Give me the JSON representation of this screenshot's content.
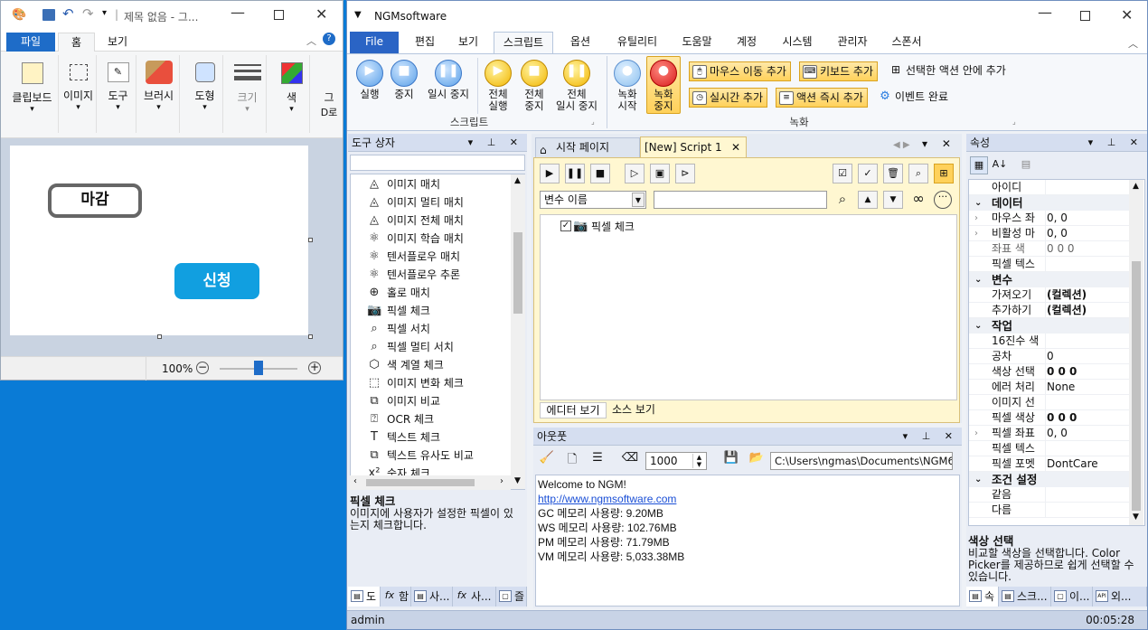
{
  "paint": {
    "title": "제목 없음 - 그...",
    "tabs": [
      "파일",
      "홈",
      "보기"
    ],
    "groups": [
      {
        "label": "클립보드"
      },
      {
        "label": "이미지"
      },
      {
        "label": "도구"
      },
      {
        "label": "브러시"
      },
      {
        "label": "도형"
      },
      {
        "label": "크기"
      },
      {
        "label": "색"
      },
      {
        "label": "그"
      }
    ],
    "btn_close_label": "마감",
    "btn_apply_label": "신청",
    "zoom": "100%"
  },
  "ngm": {
    "title": "NGMsoftware",
    "tabs": [
      "File",
      "편집",
      "보기",
      "스크립트",
      "옵션",
      "유틸리티",
      "도움말",
      "계정",
      "시스템",
      "관리자",
      "스폰서"
    ],
    "script_group": {
      "label": "스크립트",
      "buttons": [
        "실행",
        "중지",
        "일시 중지",
        "전체\n실행",
        "전체\n중지",
        "전체\n일시 중지"
      ]
    },
    "record_group": {
      "label": "녹화",
      "buttons": [
        "녹화\n시작",
        "녹화\n중지"
      ],
      "small": [
        "마우스 이동 추가",
        "키보드 추가",
        "선택한 액션 안에 추가",
        "실시간 추가",
        "액션 즉시 추가",
        "이벤트 완료"
      ]
    },
    "toolbox": {
      "title": "도구 상자",
      "items": [
        "이미지 매치",
        "이미지 멀티 매치",
        "이미지 전체 매치",
        "이미지 학습 매치",
        "텐서플로우 매치",
        "텐서플로우 추론",
        "홀로 매치",
        "픽셀 체크",
        "픽셀 서치",
        "픽셀 멀티 서치",
        "색 계열 체크",
        "이미지 변화 체크",
        "이미지 비교",
        "OCR 체크",
        "텍스트 체크",
        "텍스트 유사도 비교",
        "숫자 체크"
      ],
      "desc_title": "픽셀 체크",
      "desc_text": "이미지에 사용자가 설정한 픽셀이 있는지 체크합니다.",
      "bottom_tabs": [
        "도",
        "함",
        "사...",
        "사...",
        "즐"
      ]
    },
    "doc_tabs": [
      "시작 페이지",
      "[New] Script 1"
    ],
    "editor": {
      "variable_dropdown": "변수 이름",
      "tree_item": "픽셀 체크",
      "view_tabs": [
        "에디터 보기",
        "소스 보기"
      ]
    },
    "output": {
      "title": "아웃풋",
      "count": "1000",
      "path": "C:\\Users\\ngmas\\Documents\\NGM6\\",
      "lines": [
        "Welcome to NGM!",
        "http://www.ngmsoftware.com",
        "GC 메모리 사용량: 9.20MB",
        "WS 메모리 사용량: 102.76MB",
        "PM 메모리 사용량: 71.79MB",
        "VM 메모리 사용량: 5,033.38MB"
      ]
    },
    "properties": {
      "title": "속성",
      "rows": [
        {
          "type": "row",
          "k": "아이디",
          "v": ""
        },
        {
          "type": "cat",
          "k": "데이터"
        },
        {
          "type": "row",
          "k": "마우스 좌",
          "v": "0, 0"
        },
        {
          "type": "row",
          "k": "비활성 마",
          "v": "0, 0"
        },
        {
          "type": "row",
          "k": "좌표 색",
          "v": "0 0 0"
        },
        {
          "type": "row",
          "k": "픽셀 텍스",
          "v": ""
        },
        {
          "type": "cat",
          "k": "변수"
        },
        {
          "type": "row",
          "k": "가져오기",
          "v": "(컬렉션)"
        },
        {
          "type": "row",
          "k": "추가하기",
          "v": "(컬렉션)"
        },
        {
          "type": "cat",
          "k": "작업"
        },
        {
          "type": "row",
          "k": "16진수 색",
          "v": ""
        },
        {
          "type": "row",
          "k": "공차",
          "v": "0"
        },
        {
          "type": "row",
          "k": "색상 선택",
          "v": "0 0 0"
        },
        {
          "type": "row",
          "k": "에러 처리",
          "v": "None"
        },
        {
          "type": "row",
          "k": "이미지 선",
          "v": ""
        },
        {
          "type": "row",
          "k": "픽셀 색상",
          "v": "0 0 0"
        },
        {
          "type": "row",
          "k": "픽셀 좌표",
          "v": "0, 0"
        },
        {
          "type": "row",
          "k": "픽셀 텍스",
          "v": ""
        },
        {
          "type": "row",
          "k": "픽셀 포멧",
          "v": "DontCare"
        },
        {
          "type": "cat",
          "k": "조건 설정"
        },
        {
          "type": "row",
          "k": "같음",
          "v": ""
        },
        {
          "type": "row",
          "k": "다름",
          "v": ""
        }
      ],
      "desc_title": "색상 선택",
      "desc_text": "비교할 색상을 선택합니다. Color Picker를 제공하므로 쉽게 선택할 수 있습니다.",
      "bottom_tabs": [
        "속",
        "스크...",
        "이...",
        "외..."
      ]
    },
    "status": {
      "user": "admin",
      "time": "00:05:28"
    }
  }
}
